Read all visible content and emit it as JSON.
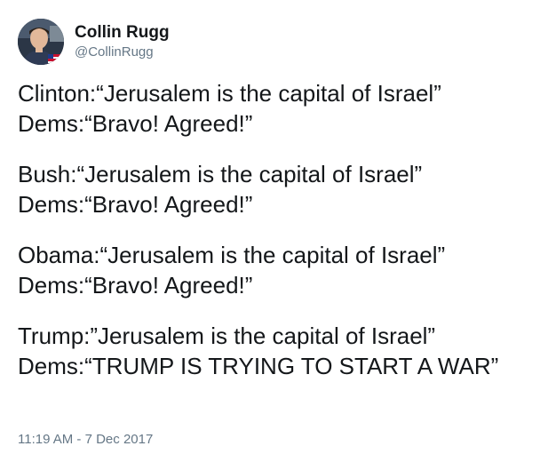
{
  "author": {
    "display_name": "Collin Rugg",
    "handle": "@CollinRugg",
    "avatar_icon": "profile-photo-icon"
  },
  "tweet": {
    "paragraphs": [
      {
        "line1": "Clinton:“Jerusalem is the capital of Israel”",
        "line2": "Dems:“Bravo! Agreed!”"
      },
      {
        "line1": "Bush:“Jerusalem is the capital of Israel”",
        "line2": "Dems:“Bravo! Agreed!”"
      },
      {
        "line1": "Obama:“Jerusalem is the capital of Israel”",
        "line2": "Dems:“Bravo! Agreed!”"
      },
      {
        "line1": "Trump:”Jerusalem is the capital of Israel”",
        "line2": "Dems:“TRUMP IS TRYING TO START A WAR”"
      }
    ],
    "timestamp": "11:19 AM - 7 Dec 2017"
  },
  "colors": {
    "text": "#14171a",
    "secondary": "#657786",
    "background": "#ffffff"
  }
}
